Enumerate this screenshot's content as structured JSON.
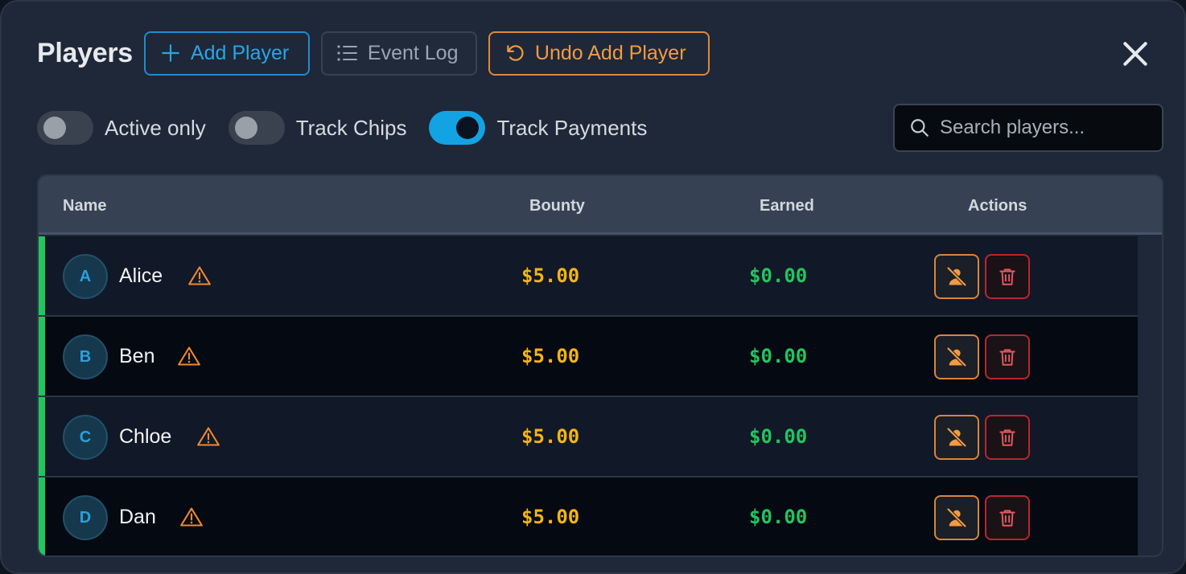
{
  "header": {
    "title": "Players",
    "add_label": "Add Player",
    "log_label": "Event Log",
    "undo_label": "Undo Add Player"
  },
  "toggles": [
    {
      "label": "Active only",
      "on": false
    },
    {
      "label": "Track Chips",
      "on": false
    },
    {
      "label": "Track Payments",
      "on": true
    }
  ],
  "search": {
    "placeholder": "Search players..."
  },
  "table": {
    "columns": {
      "name": "Name",
      "bounty": "Bounty",
      "earned": "Earned",
      "actions": "Actions"
    },
    "rows": [
      {
        "initial": "A",
        "name": "Alice",
        "bounty": "$5.00",
        "earned": "$0.00"
      },
      {
        "initial": "B",
        "name": "Ben",
        "bounty": "$5.00",
        "earned": "$0.00"
      },
      {
        "initial": "C",
        "name": "Chloe",
        "bounty": "$5.00",
        "earned": "$0.00"
      },
      {
        "initial": "D",
        "name": "Dan",
        "bounty": "$5.00",
        "earned": "$0.00"
      }
    ]
  },
  "colors": {
    "accent_blue": "#13a2e2",
    "accent_orange": "#f29a44",
    "bounty_yellow": "#f4b513",
    "earned_green": "#22c55e",
    "delete_red": "#e05a60"
  },
  "icons": [
    "plus-icon",
    "list-icon",
    "undo-icon",
    "close-icon",
    "search-icon",
    "warning-icon",
    "user-off-icon",
    "trash-icon"
  ]
}
